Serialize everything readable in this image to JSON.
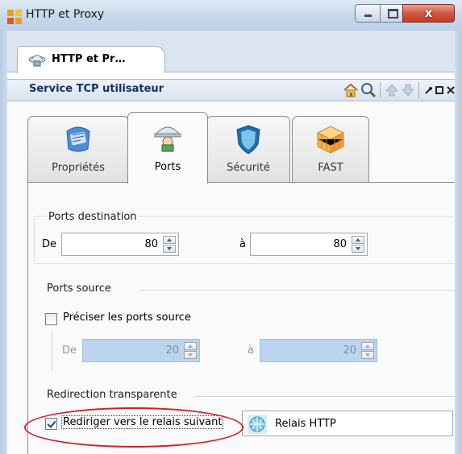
{
  "window": {
    "title": "HTTP et Proxy",
    "close_glyph": "x"
  },
  "doc_tab": {
    "label": "HTTP et Pr…",
    "icon": "network-service-icon"
  },
  "panel": {
    "title": "Service TCP utilisateur",
    "tools": [
      "home-icon",
      "search-icon",
      "arrow-up-icon",
      "arrow-down-icon",
      "pin-icon",
      "maximize-icon",
      "close-icon"
    ]
  },
  "tabs": [
    {
      "label": "Propriétés",
      "icon": "properties-icon",
      "active": false
    },
    {
      "label": "Ports",
      "icon": "ports-icon",
      "active": true
    },
    {
      "label": "Sécurité",
      "icon": "shield-icon",
      "active": false
    },
    {
      "label": "FAST",
      "icon": "fast-cube-icon",
      "active": false
    }
  ],
  "dest_ports": {
    "title": "Ports destination",
    "from_label": "De",
    "from_value": "80",
    "to_label": "à",
    "to_value": "80"
  },
  "source_ports": {
    "title": "Ports source",
    "checkbox_label": "Préciser les ports source",
    "checked": false,
    "from_label": "De",
    "from_value": "20",
    "to_label": "à",
    "to_value": "20"
  },
  "redirect": {
    "title": "Redirection transparente",
    "checkbox_label": "Rediriger vers le relais suivant",
    "checked": true,
    "relay_value": "Relais HTTP"
  },
  "colors": {
    "highlight": "#d0212a",
    "panel_title": "#15305a",
    "disabled_field": "#bdd4ee"
  }
}
